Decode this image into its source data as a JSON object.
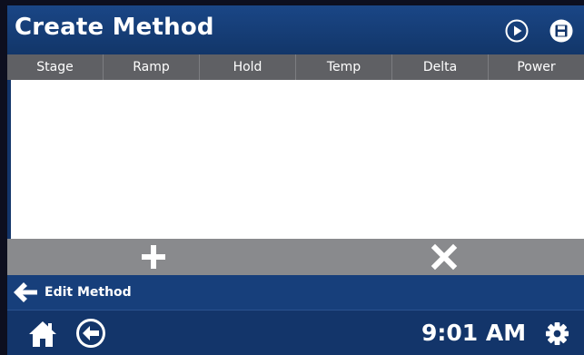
{
  "header": {
    "title": "Create Method",
    "play_icon": "play-circle-icon",
    "save_icon": "save-disk-icon"
  },
  "table": {
    "columns": [
      "Stage",
      "Ramp",
      "Hold",
      "Temp",
      "Delta",
      "Power"
    ],
    "rows": []
  },
  "actions": {
    "add_icon": "plus-icon",
    "delete_icon": "x-icon"
  },
  "breadcrumb": {
    "label": "Edit Method"
  },
  "footer": {
    "time": "9:01 AM",
    "home_icon": "home-icon",
    "back_icon": "back-circle-icon",
    "settings_icon": "gear-icon"
  },
  "colors": {
    "header_blue": "#1a4686",
    "table_header_gray": "#5f6064",
    "action_bar_gray": "#898a8d",
    "footer_blue": "#13356a"
  }
}
